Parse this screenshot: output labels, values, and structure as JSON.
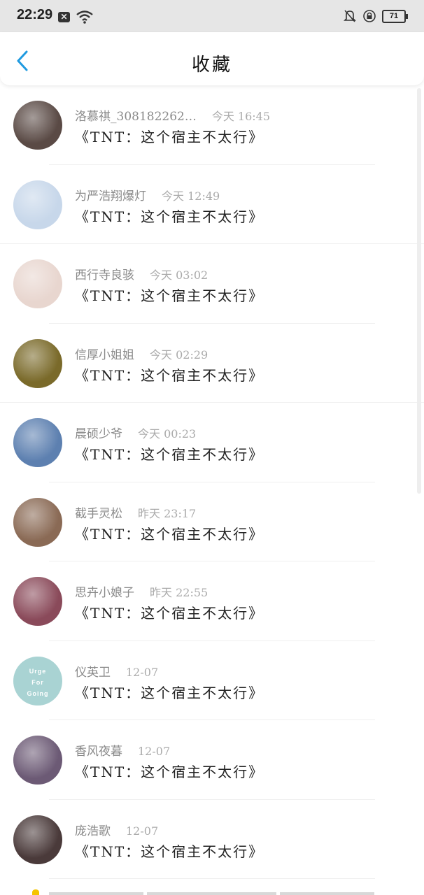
{
  "status_bar": {
    "time": "22:29",
    "battery": "71",
    "icons": [
      "notification-x-icon",
      "wifi-icon",
      "bell-muted-icon",
      "lock-rotation-icon",
      "battery-icon"
    ]
  },
  "nav": {
    "back_icon": "chevron-left-icon",
    "title": "收藏",
    "accent_color": "#1f9ae0"
  },
  "items": [
    {
      "user": "洛慕祺_308182262…",
      "time": "今天 16:45",
      "title": "《TNT：这个宿主不太行》",
      "avatar_color": "#5a4a45"
    },
    {
      "user": "为严浩翔爆灯",
      "time": "今天 12:49",
      "title": "《TNT：这个宿主不太行》",
      "avatar_color": "#c7d7ea"
    },
    {
      "user": "西行寺良骇",
      "time": "今天 03:02",
      "title": "《TNT：这个宿主不太行》",
      "avatar_color": "#e8d6cf"
    },
    {
      "user": "信厚小姐姐",
      "time": "今天 02:29",
      "title": "《TNT：这个宿主不太行》",
      "avatar_color": "#7a6a2a"
    },
    {
      "user": "晨硕少爷",
      "time": "今天 00:23",
      "title": "《TNT：这个宿主不太行》",
      "avatar_color": "#5d80b0"
    },
    {
      "user": "截手灵松",
      "time": "昨天 23:17",
      "title": "《TNT：这个宿主不太行》",
      "avatar_color": "#8a6a55"
    },
    {
      "user": "思卉小娘子",
      "time": "昨天 22:55",
      "title": "《TNT：这个宿主不太行》",
      "avatar_color": "#8a4a5a"
    },
    {
      "user": "仪英卫",
      "time": "12-07",
      "title": "《TNT：这个宿主不太行》",
      "avatar_color": "#a9d3d3",
      "avatar_text": [
        "Urge",
        "For",
        "Going"
      ]
    },
    {
      "user": "香风夜暮",
      "time": "12-07",
      "title": "《TNT：这个宿主不太行》",
      "avatar_color": "#6c5a75"
    },
    {
      "user": "庞浩歌",
      "time": "12-07",
      "title": "《TNT：这个宿主不太行》",
      "avatar_color": "#4a3a3a"
    }
  ]
}
